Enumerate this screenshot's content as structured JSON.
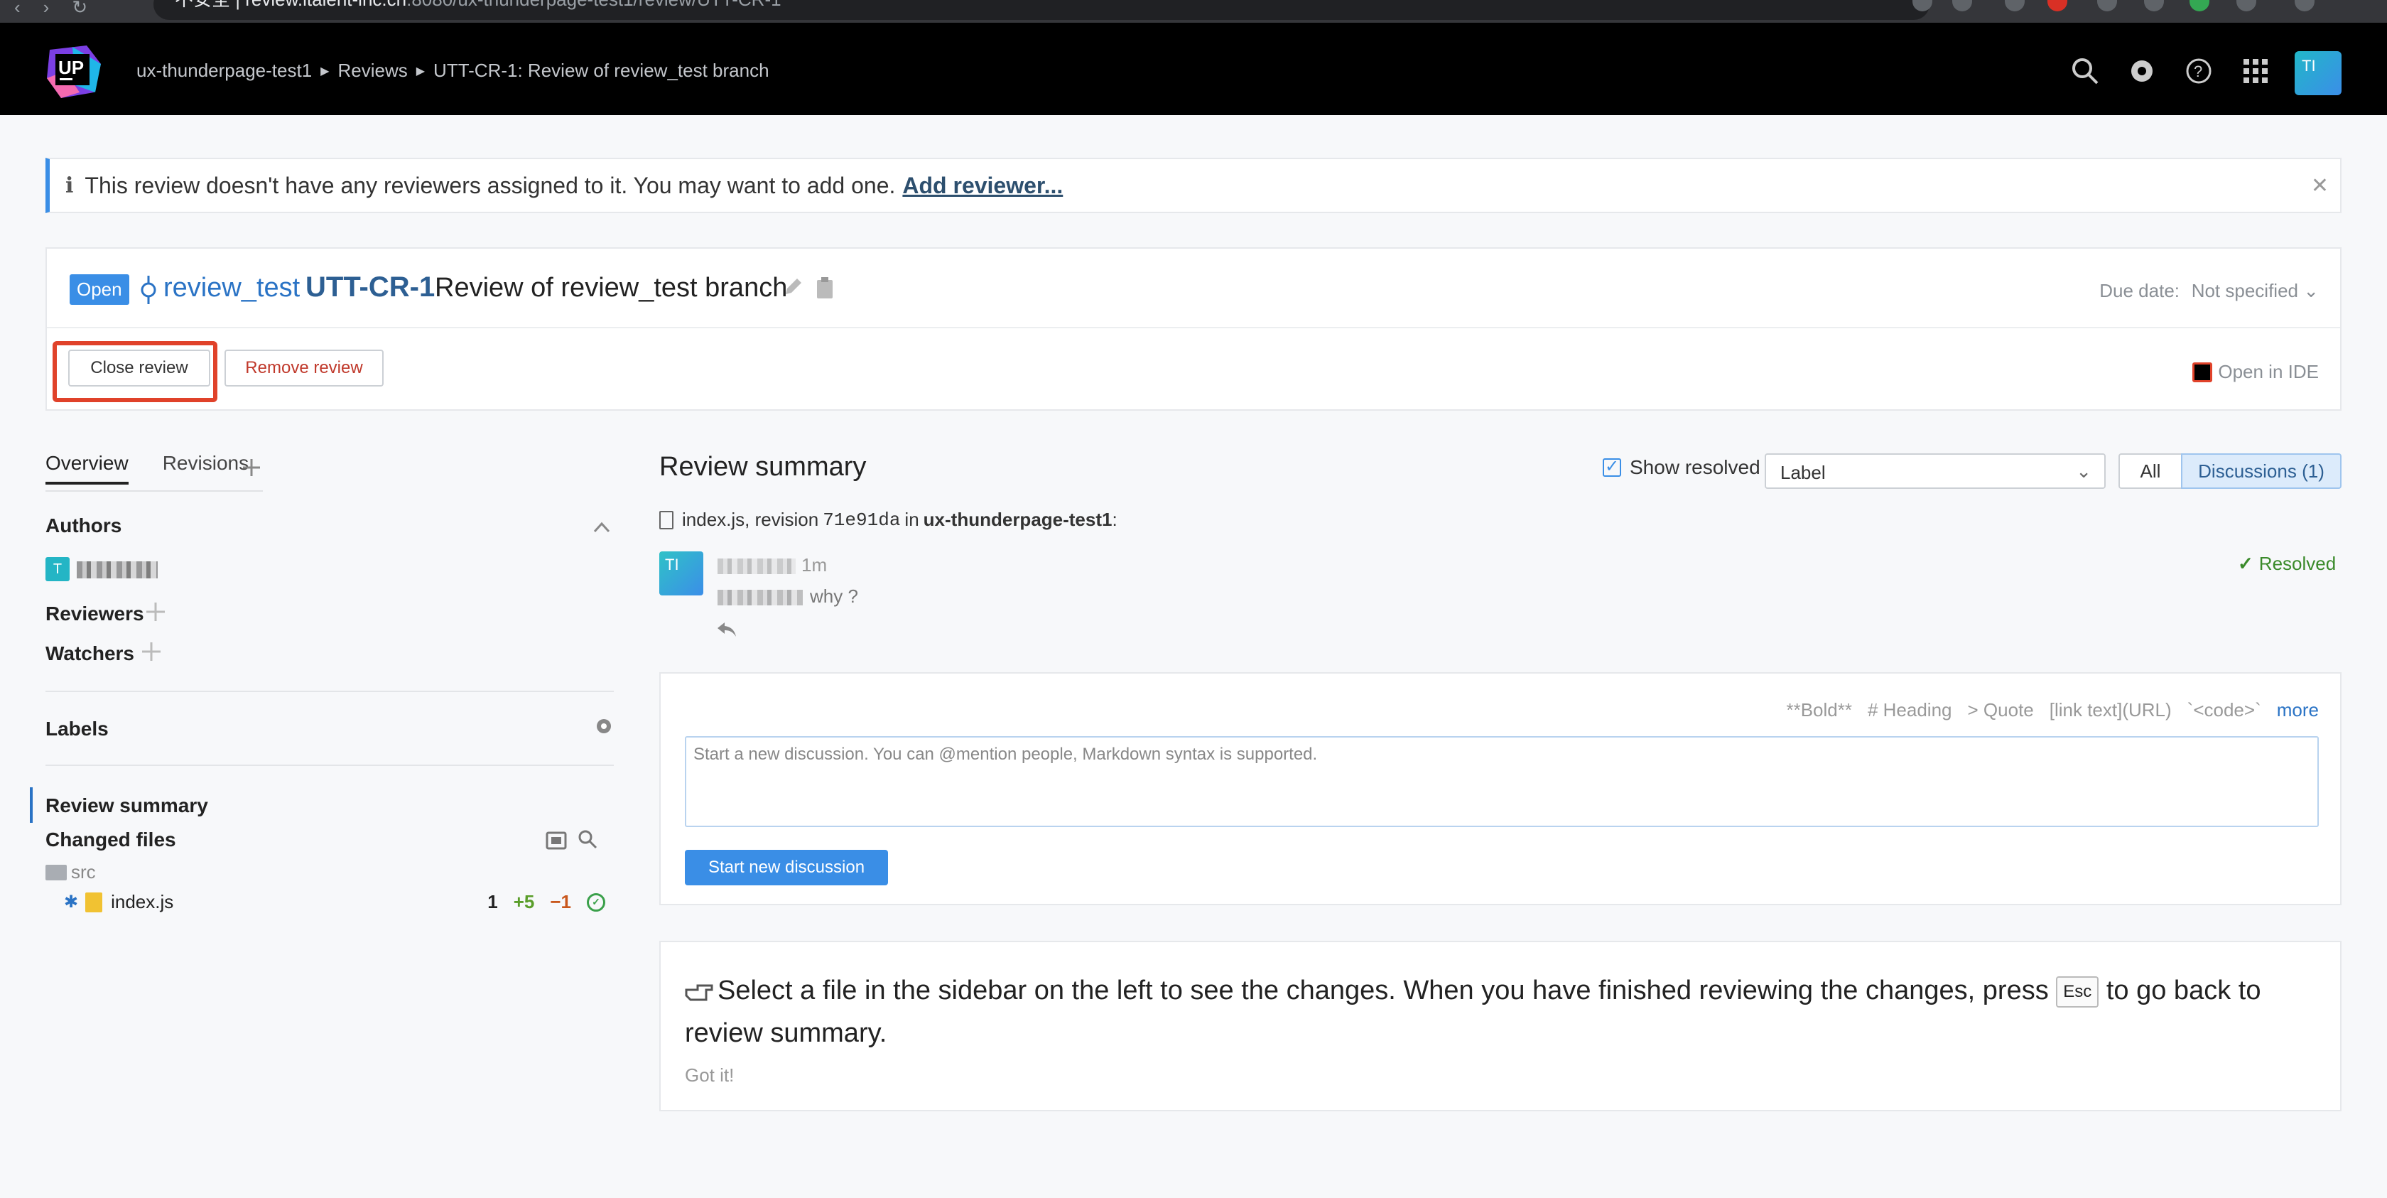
{
  "browser": {
    "url_security": "不安全",
    "url_host": "review.italent-inc.cn",
    "url_path": ":8080/ux-thunderpage-test1/review/UTT-CR-1"
  },
  "header": {
    "logo_text": "UP",
    "breadcrumb": [
      "ux-thunderpage-test1",
      "Reviews",
      "UTT-CR-1: Review of review_test branch"
    ],
    "avatar_initials": "TI"
  },
  "banner": {
    "message": "This review doesn't have any reviewers assigned to it. You may want to add one.",
    "link": "Add reviewer..."
  },
  "review": {
    "status": "Open",
    "branch": "review_test",
    "id": "UTT-CR-1",
    "title": "Review of review_test branch",
    "due_label": "Due date:",
    "due_value": "Not specified ⌄",
    "close_button": "Close review",
    "remove_button": "Remove review",
    "open_ide": "Open in IDE"
  },
  "sidebar": {
    "tabs": [
      "Overview",
      "Revisions"
    ],
    "authors_label": "Authors",
    "author_initial": "T",
    "reviewers_label": "Reviewers",
    "watchers_label": "Watchers",
    "labels_label": "Labels",
    "nav": [
      "Review summary",
      "Changed files"
    ],
    "folder": "src",
    "file": {
      "name": "index.js",
      "count": "1",
      "added": "+5",
      "removed": "−1"
    }
  },
  "main": {
    "summary_title": "Review summary",
    "show_resolved": "Show resolved",
    "label_placeholder": "Label",
    "filter_all": "All",
    "filter_discussions": "Discussions (1)",
    "file_ref": {
      "file": "index.js, revision",
      "revision": "71e91da",
      "in": "in",
      "project": "ux-thunderpage-test1",
      "colon": ":"
    },
    "comment": {
      "avatar_initials": "TI",
      "time": "1m",
      "text": "why ?",
      "resolved": "Resolved"
    },
    "editor": {
      "hints": [
        "**Bold**",
        "# Heading",
        "> Quote",
        "[link text](URL)",
        "`<code>`"
      ],
      "more": "more",
      "placeholder": "Start a new discussion. You can @mention people, Markdown syntax is supported.",
      "submit": "Start new discussion"
    },
    "tip": {
      "before": "Select a file in the sidebar on the left to see the changes. When you have finished reviewing the changes, press",
      "key": "Esc",
      "after": "to go back to review summary.",
      "dismiss": "Got it!"
    }
  },
  "colors": {
    "accent": "#3a8ee6",
    "link": "#2a73c5",
    "highlight": "#e0422a",
    "added": "#5a9e2a",
    "removed": "#c9571c"
  }
}
